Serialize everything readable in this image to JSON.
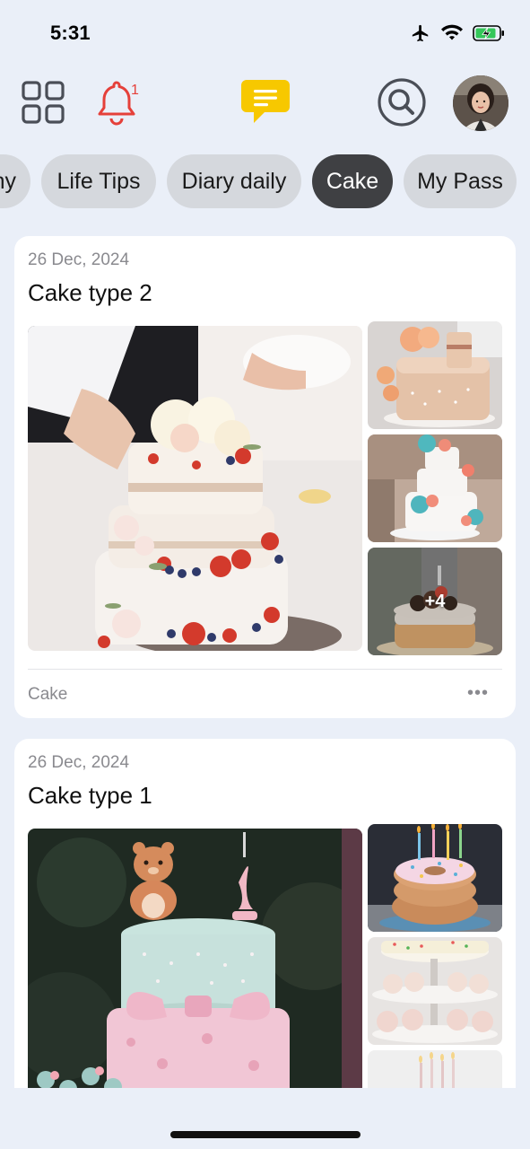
{
  "status_bar": {
    "time": "5:31"
  },
  "header": {
    "notification_count": "1"
  },
  "chips": [
    {
      "label": "ny",
      "active": false
    },
    {
      "label": "Life Tips",
      "active": false
    },
    {
      "label": "Diary daily",
      "active": false
    },
    {
      "label": "Cake",
      "active": true
    },
    {
      "label": "My Pass",
      "active": false
    }
  ],
  "posts": [
    {
      "date": "26 Dec, 2024",
      "title": "Cake type 2",
      "more_photos": "+4",
      "category": "Cake",
      "menu": "•••"
    },
    {
      "date": "26 Dec, 2024",
      "title": "Cake type 1"
    }
  ],
  "colors": {
    "background": "#eaeff8",
    "active_chip": "#3f4043",
    "chip": "#d5d8dd",
    "notification_red": "#e5403a",
    "chat_yellow": "#f7c800",
    "icon_gray": "#4a4e57"
  }
}
